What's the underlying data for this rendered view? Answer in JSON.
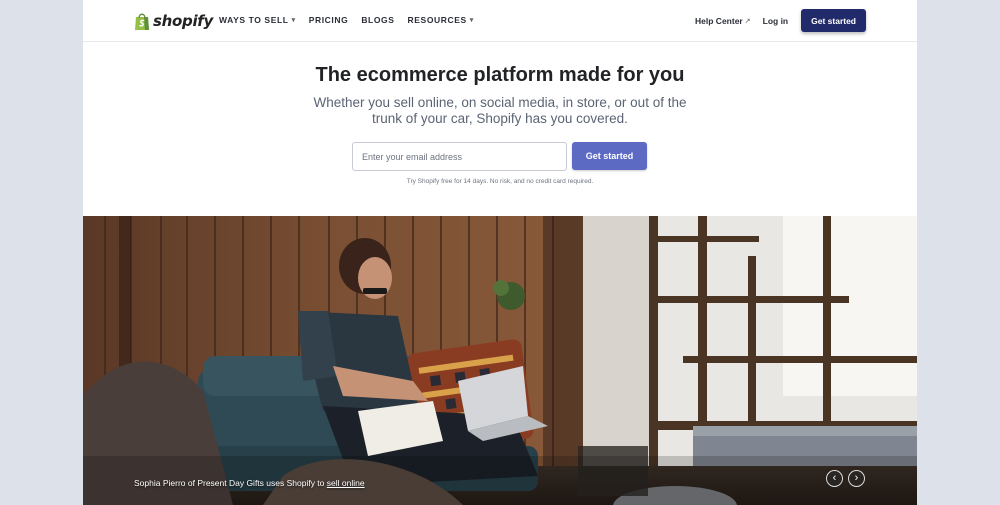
{
  "brand": {
    "name": "shopify",
    "color": "#95bf47"
  },
  "nav": {
    "items": [
      {
        "label": "WAYS TO SELL",
        "dropdown": true
      },
      {
        "label": "PRICING",
        "dropdown": false
      },
      {
        "label": "BLOGS",
        "dropdown": false
      },
      {
        "label": "RESOURCES",
        "dropdown": true
      }
    ],
    "help_label": "Help Center",
    "login_label": "Log in",
    "cta_label": "Get started"
  },
  "hero": {
    "title": "The ecommerce platform made for you",
    "subtitle": "Whether you sell online, on social media, in store, or out of the trunk of your car, Shopify has you covered.",
    "email_placeholder": "Enter your email address",
    "cta_label": "Get started",
    "trial_note": "Try Shopify free for 14 days. No risk, and no credit card required."
  },
  "photo": {
    "caption_prefix": "Sophia Pierro of Present Day Gifts uses Shopify to ",
    "caption_link": "sell online",
    "prev_icon": "chevron-left-icon",
    "next_icon": "chevron-right-icon"
  },
  "colors": {
    "accent_dark": "#212b6b",
    "accent_purple": "#5c6ac4",
    "page_bg": "#dde1ea"
  }
}
